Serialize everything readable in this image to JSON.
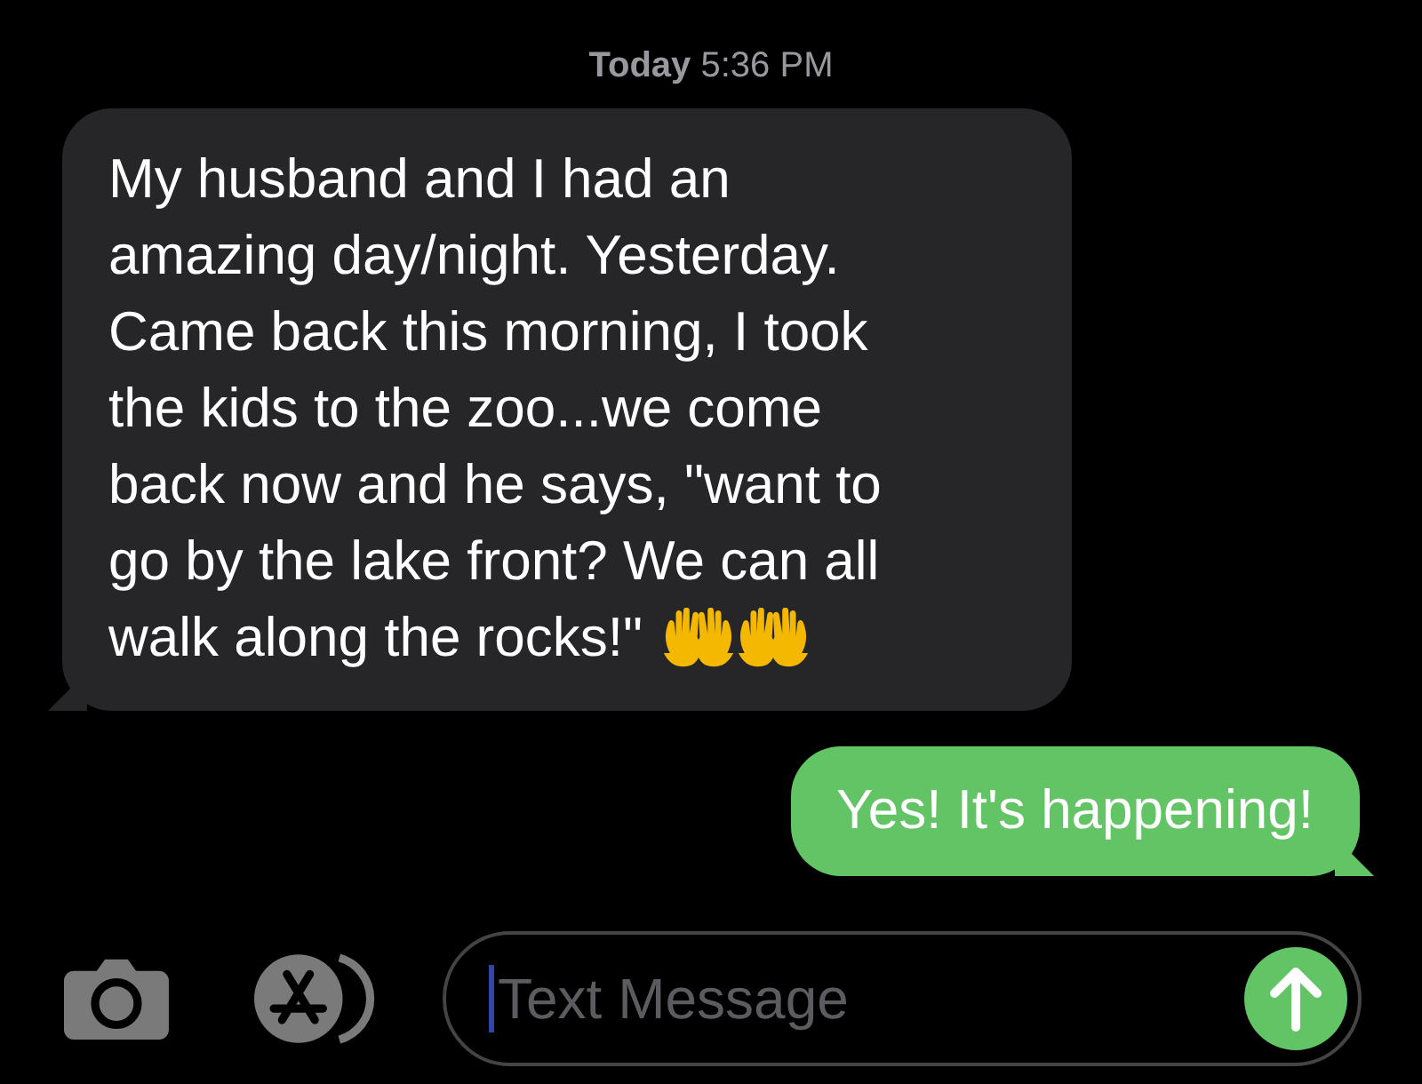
{
  "timestamp": {
    "day": "Today",
    "time": "5:36 PM"
  },
  "messages": [
    {
      "kind": "received",
      "lines": [
        "My husband and I had an",
        "amazing day/night. Yesterday.",
        "Came back this morning, I took",
        "the kids to the zoo...we come",
        "back now and he says, \"want to",
        "go by the lake front? We can all",
        "walk along the rocks!\""
      ]
    },
    {
      "kind": "sent",
      "lines": [
        "Yes! It's happening!"
      ]
    }
  ],
  "composer": {
    "placeholder": "Text Message"
  }
}
